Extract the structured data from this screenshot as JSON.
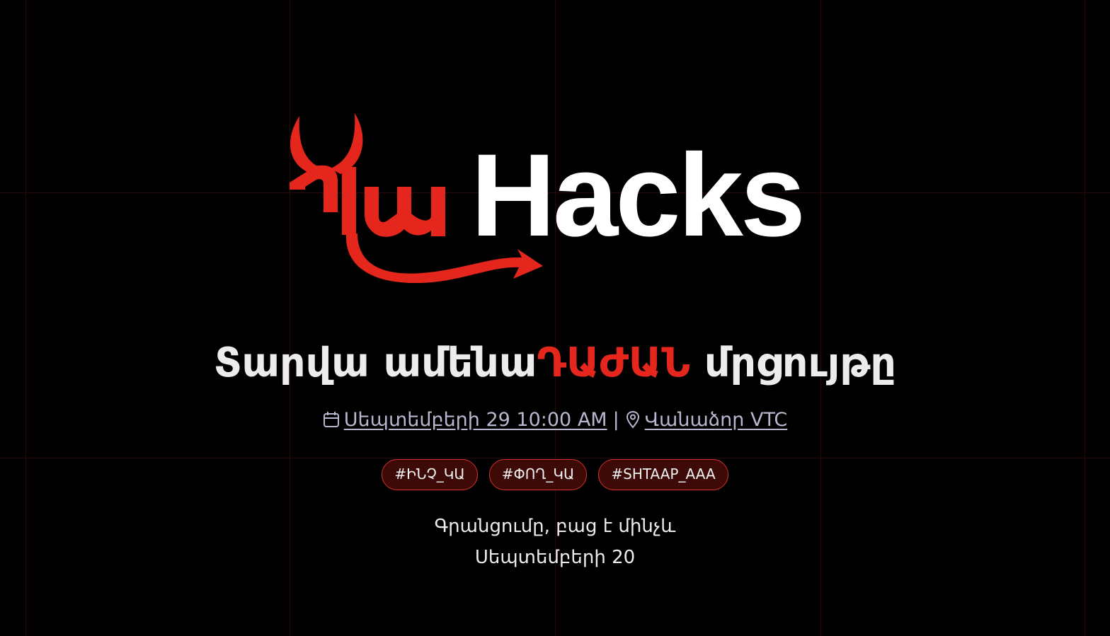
{
  "colors": {
    "background": "#000000",
    "accent": "#e4261c",
    "text": "#ececec",
    "link": "#b7b7cf",
    "tag_border": "#d63329",
    "tag_background": "#3d0a08"
  },
  "logo": {
    "prefix_text": "Դա",
    "word": "Hacks",
    "icon": "devil-horns-tail-icon"
  },
  "headline": {
    "before": "Տարվա ամենա",
    "accent": "ԴԱԺԱՆ",
    "after": " մրցույթը"
  },
  "event": {
    "calendar_icon": "calendar-icon",
    "date": "Սեպտեմբերի 29 10:00 AM",
    "separator": "|",
    "location_icon": "map-pin-icon",
    "location": "Վանաձոր VTC"
  },
  "tags": [
    "#ԻՆՉ_ԿԱ",
    "#ՓՈՂ_ԿԱ",
    "#SHTAAP_AAA"
  ],
  "registration": {
    "line1": "Գրանցումը, բաց է մինչև",
    "line2": "Սեպտեմբերի 20"
  }
}
